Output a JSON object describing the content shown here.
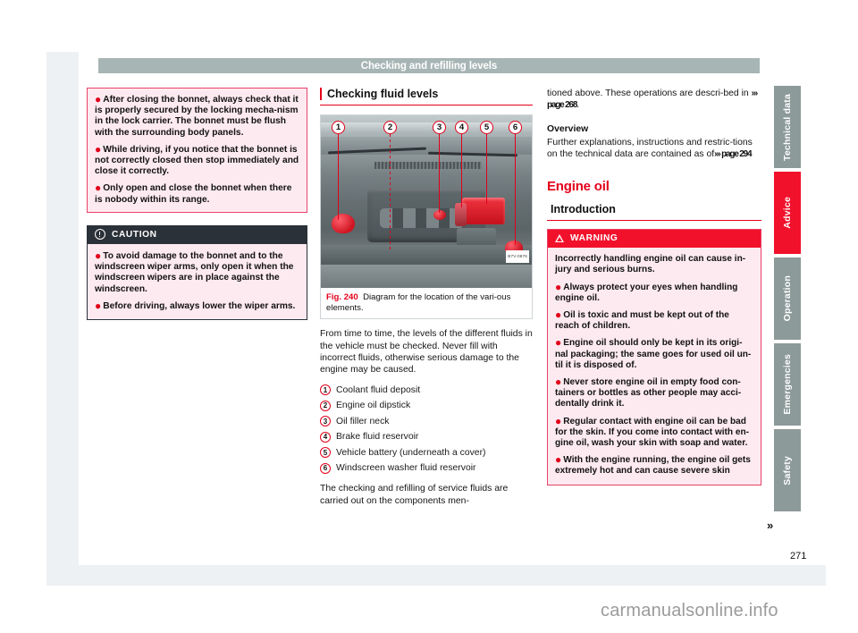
{
  "document": {
    "running_header": "Checking and refilling levels",
    "page_number": "271",
    "continuation_marker": "»",
    "watermark": "carmanualsonline.info"
  },
  "left_column": {
    "note_box": {
      "paragraphs": [
        "After closing the bonnet, always check that it is properly secured by the locking mecha-nism in the lock carrier. The bonnet must be flush with the surrounding body panels.",
        "While driving, if you notice that the bonnet is not correctly closed then stop immediately and close it correctly.",
        "Only open and close the bonnet when there is nobody within its range."
      ]
    },
    "caution_box": {
      "icon": "exclaim-circle-icon",
      "title": "CAUTION",
      "paragraphs": [
        "To avoid damage to the bonnet and to the windscreen wiper arms, only open it when the windscreen wipers are in place against the windscreen.",
        "Before driving, always lower the wiper arms."
      ]
    }
  },
  "middle_column": {
    "section_heading": "Checking fluid levels",
    "figure": {
      "callouts": [
        "1",
        "2",
        "3",
        "4",
        "5",
        "6"
      ],
      "photo_credit": "B7V-0876",
      "caption_label": "Fig. 240",
      "caption_text": "Diagram for the location of the vari-ous elements."
    },
    "intro_paragraph": "From time to time, the levels of the different fluids in the vehicle must be checked. Never fill with incorrect fluids, otherwise serious damage to the engine may be caused.",
    "numbered_items": [
      {
        "num": "1",
        "label": "Coolant fluid deposit"
      },
      {
        "num": "2",
        "label": "Engine oil dipstick"
      },
      {
        "num": "3",
        "label": "Oil filler neck"
      },
      {
        "num": "4",
        "label": "Brake fluid reservoir"
      },
      {
        "num": "5",
        "label": "Vehicle battery (underneath a cover)"
      },
      {
        "num": "6",
        "label": "Windscreen washer fluid reservoir"
      }
    ],
    "closing_paragraph": "The checking and refilling of service fluids are carried out on the components men-"
  },
  "right_column": {
    "continued_paragraph_part1": "tioned above. These operations are descri-bed in ",
    "continued_reference": "››› page 268",
    "continued_paragraph_end": ".",
    "overview_heading": "Overview",
    "overview_text_part1": "Further explanations, instructions and restric-tions on the technical data are contained as of",
    "overview_reference": "››› page 294",
    "red_title": "Engine oil",
    "sub_heading": "Introduction",
    "warning_box": {
      "icon": "warning-triangle-icon",
      "title": "WARNING",
      "lead": "Incorrectly handling engine oil can cause in-jury and serious burns.",
      "paragraphs": [
        "Always protect your eyes when handling engine oil.",
        "Oil is toxic and must be kept out of the reach of children.",
        "Engine oil should only be kept in its origi-nal packaging; the same goes for used oil un-til it is disposed of.",
        "Never store engine oil in empty food con-tainers or bottles as other people may acci-dentally drink it.",
        "Regular contact with engine oil can be bad for the skin. If you come into contact with en-gine oil, wash your skin with soap and water.",
        "With the engine running, the engine oil gets extremely hot and can cause severe skin"
      ]
    }
  },
  "side_tabs": [
    {
      "label": "Technical data",
      "active": false
    },
    {
      "label": "Advice",
      "active": true
    },
    {
      "label": "Operation",
      "active": false
    },
    {
      "label": "Emergencies",
      "active": false
    },
    {
      "label": "Safety",
      "active": false
    }
  ],
  "colors": {
    "brand_red": "#e2001a",
    "warning_red": "#f2112b",
    "alert_bg": "#fdeaf0",
    "caution_dark": "#2b3138",
    "header_band": "#a7b5b4",
    "tab_grey": "#8c9a99",
    "viewer_bg": "#eef1f3"
  }
}
